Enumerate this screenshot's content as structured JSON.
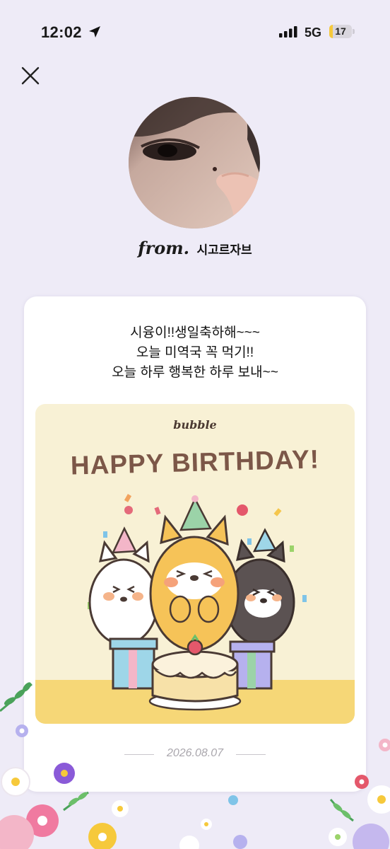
{
  "status_bar": {
    "time": "12:02",
    "network": "5G",
    "battery_level": "17",
    "battery_fraction": 0.17
  },
  "icons": {
    "close": "close-icon",
    "location": "location-arrow-icon",
    "signal": "signal-bars-icon"
  },
  "header": {
    "from_label": "from.",
    "sender_name": "시고르자브"
  },
  "letter": {
    "lines": [
      "시융이!!생일축하해~~~",
      "오늘 미역국 꼭 먹기!!",
      "오늘 하루 행복한 하루 보내~~"
    ],
    "image": {
      "brand": "bubble",
      "title": "HAPPY BIRTHDAY!"
    },
    "date": "2026.08.07"
  },
  "colors": {
    "background": "#eeebf7",
    "card": "#ffffff",
    "image_bg": "#f8f1d5",
    "title_brown": "#7c5748",
    "battery_yellow": "#f6c93b"
  }
}
